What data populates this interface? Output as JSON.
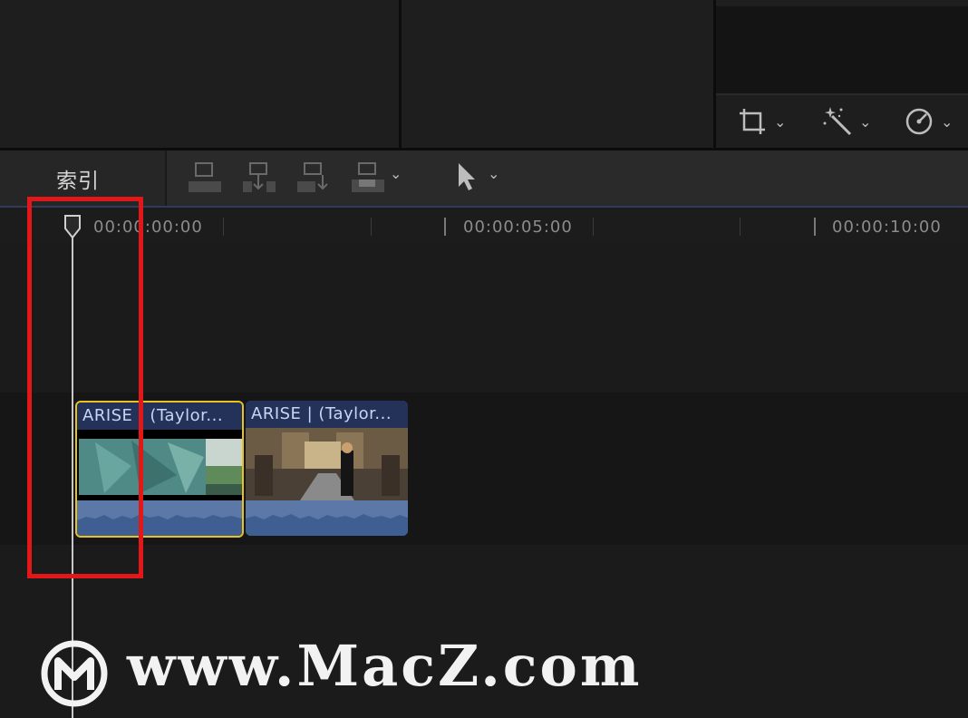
{
  "viewer_tools": [
    {
      "icon": "crop-icon"
    },
    {
      "icon": "magic-wand-icon"
    },
    {
      "icon": "speed-gauge-icon"
    }
  ],
  "timeline_toolbar": {
    "index_label": "索引",
    "edit_buttons": [
      "connect-clip-icon",
      "insert-clip-icon",
      "append-clip-icon",
      "overwrite-clip-icon"
    ],
    "select_tool_icon": "arrow-cursor-icon"
  },
  "ruler": {
    "timecodes": [
      "00:00:00:00",
      "00:00:05:00",
      "00:00:10:00"
    ]
  },
  "clips": [
    {
      "title": "ARISE | (Taylor...",
      "selected": true
    },
    {
      "title": "ARISE | (Taylor...",
      "selected": false
    }
  ],
  "annotation": {
    "color": "#e21818"
  },
  "colors": {
    "selection": "#e6c320",
    "clip_header": "#24325a",
    "audio": "#5c78a6"
  },
  "watermark": {
    "text": "www.MacZ.com",
    "logo": "macz-logo-icon"
  }
}
